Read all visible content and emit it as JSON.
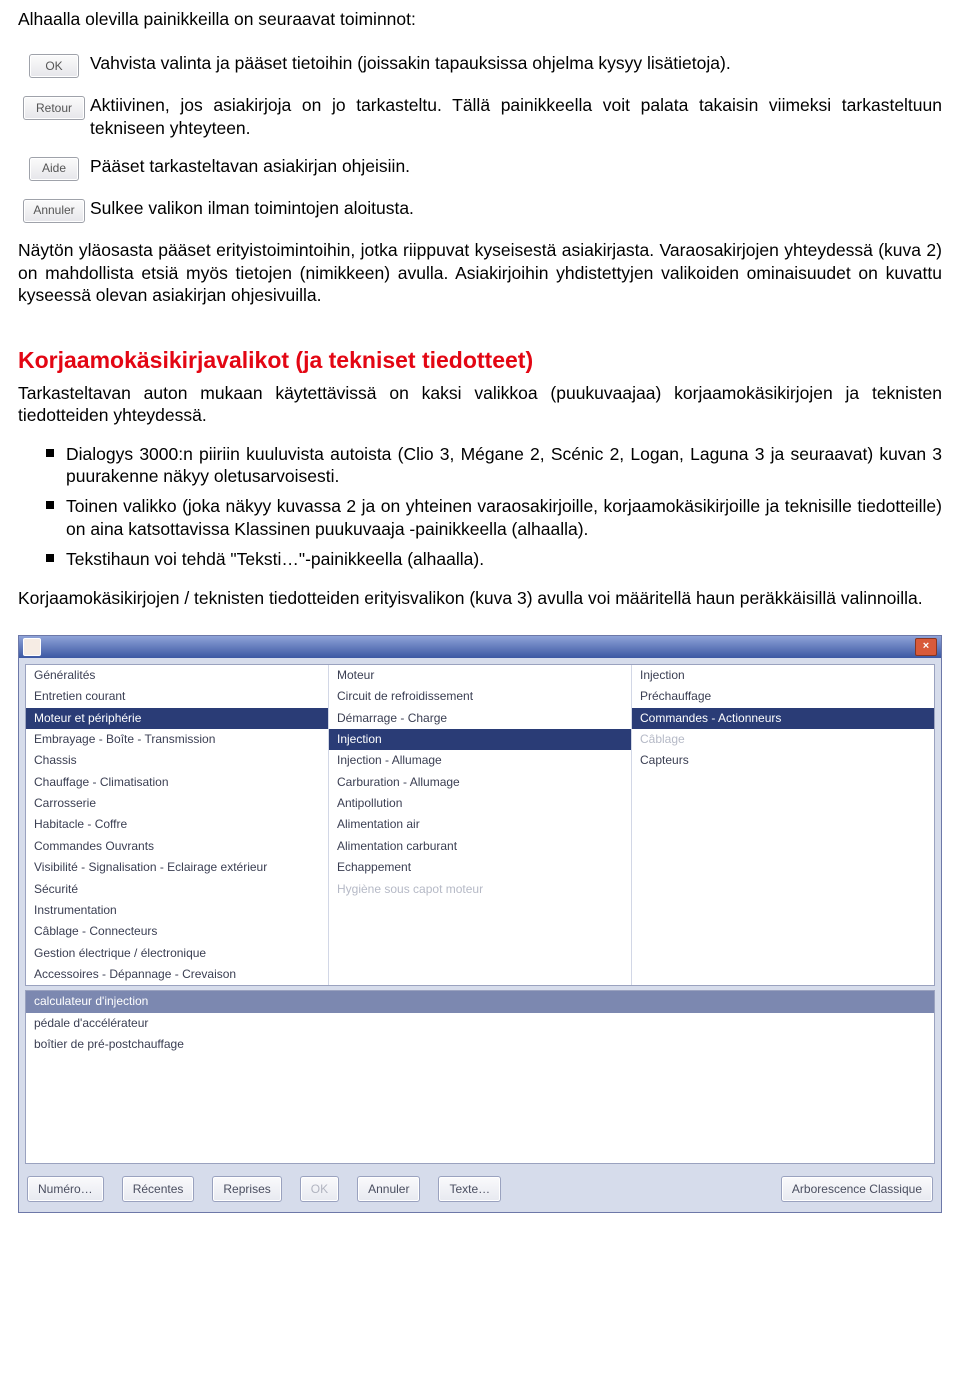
{
  "intro": "Alhaalla olevilla painikkeilla on seuraavat toiminnot:",
  "buttons": {
    "ok": {
      "label": "OK",
      "desc": "Vahvista valinta ja pääset tietoihin (joissakin tapauksissa ohjelma kysyy lisätietoja)."
    },
    "retour": {
      "label": "Retour",
      "desc": "Aktiivinen, jos asiakirjoja on jo tarkasteltu. Tällä painikkeella voit palata takaisin viimeksi tarkasteltuun tekniseen yhteyteen."
    },
    "aide": {
      "label": "Aide",
      "desc": "Pääset tarkasteltavan asiakirjan ohjeisiin."
    },
    "annuler": {
      "label": "Annuler",
      "desc": "Sulkee valikon ilman toimintojen aloitusta."
    }
  },
  "mid_para": "Näytön yläosasta pääset erityistoimintoihin, jotka riippuvat kyseisestä asiakirjasta. Varaosakirjojen yhteydessä (kuva 2) on mahdollista etsiä myös tietojen (nimikkeen) avulla. Asiakirjoihin yhdistettyjen valikoiden ominaisuudet on kuvattu kyseessä olevan asiakirjan ohjesivuilla.",
  "section_title": "Korjaamokäsikirjavalikot (ja tekniset tiedotteet)",
  "section_intro": "Tarkasteltavan auton mukaan käytettävissä on kaksi valikkoa (puukuvaajaa) korjaamokäsikirjojen ja teknisten tiedotteiden yhteydessä.",
  "bullets": [
    "Dialogys 3000:n piiriin kuuluvista autoista (Clio 3, Mégane 2, Scénic 2, Logan, Laguna 3 ja seuraavat) kuvan 3 puurakenne näkyy oletusarvoisesti.",
    "Toinen valikko (joka näkyy kuvassa 2 ja on yhteinen varaosakirjoille, korjaamokäsikirjoille ja teknisille tiedotteille) on aina katsottavissa Klassinen puukuvaaja -painikkeella (alhaalla).",
    "Tekstihaun voi tehdä \"Teksti…\"-painikkeella (alhaalla)."
  ],
  "closing": "Korjaamokäsikirjojen / teknisten tiedotteiden erityisvalikon (kuva 3) avulla voi määritellä haun peräkkäisillä valinnoilla.",
  "ui": {
    "col1": [
      {
        "t": "Généralités",
        "sel": false
      },
      {
        "t": "Entretien courant",
        "sel": false
      },
      {
        "t": "Moteur et périphérie",
        "sel": true
      },
      {
        "t": "Embrayage - Boîte - Transmission",
        "sel": false
      },
      {
        "t": "Chassis",
        "sel": false
      },
      {
        "t": "Chauffage - Climatisation",
        "sel": false
      },
      {
        "t": "Carrosserie",
        "sel": false
      },
      {
        "t": "Habitacle - Coffre",
        "sel": false
      },
      {
        "t": "Commandes Ouvrants",
        "sel": false
      },
      {
        "t": "Visibilité - Signalisation - Eclairage extérieur",
        "sel": false
      },
      {
        "t": "Sécurité",
        "sel": false
      },
      {
        "t": "Instrumentation",
        "sel": false
      },
      {
        "t": "Câblage - Connecteurs",
        "sel": false
      },
      {
        "t": "Gestion électrique / électronique",
        "sel": false
      },
      {
        "t": "Accessoires - Dépannage - Crevaison",
        "sel": false
      }
    ],
    "col2": [
      {
        "t": "Moteur",
        "sel": false
      },
      {
        "t": "Circuit de refroidissement",
        "sel": false
      },
      {
        "t": "Démarrage - Charge",
        "sel": false
      },
      {
        "t": "Injection",
        "sel": true
      },
      {
        "t": "Injection - Allumage",
        "sel": false
      },
      {
        "t": "Carburation - Allumage",
        "sel": false
      },
      {
        "t": "Antipollution",
        "sel": false
      },
      {
        "t": "Alimentation air",
        "sel": false
      },
      {
        "t": "Alimentation carburant",
        "sel": false
      },
      {
        "t": "Echappement",
        "sel": false
      },
      {
        "t": "Hygiène sous capot moteur",
        "sel": false,
        "dim": true
      }
    ],
    "col3": [
      {
        "t": "Injection",
        "sel": false
      },
      {
        "t": "Préchauffage",
        "sel": false
      },
      {
        "t": "Commandes - Actionneurs",
        "sel": true
      },
      {
        "t": "Câblage",
        "sel": false,
        "dim": true
      },
      {
        "t": "Capteurs",
        "sel": false
      }
    ],
    "low": [
      {
        "t": "calculateur d'injection",
        "sel": true
      },
      {
        "t": "pédale d'accélérateur",
        "sel": false
      },
      {
        "t": "boîtier de pré-postchauffage",
        "sel": false
      }
    ],
    "toolbar": {
      "numero": "Numéro…",
      "recentes": "Récentes",
      "reprises": "Reprises",
      "ok": "OK",
      "annuler": "Annuler",
      "texte": "Texte…",
      "arbo": "Arborescence Classique"
    }
  }
}
